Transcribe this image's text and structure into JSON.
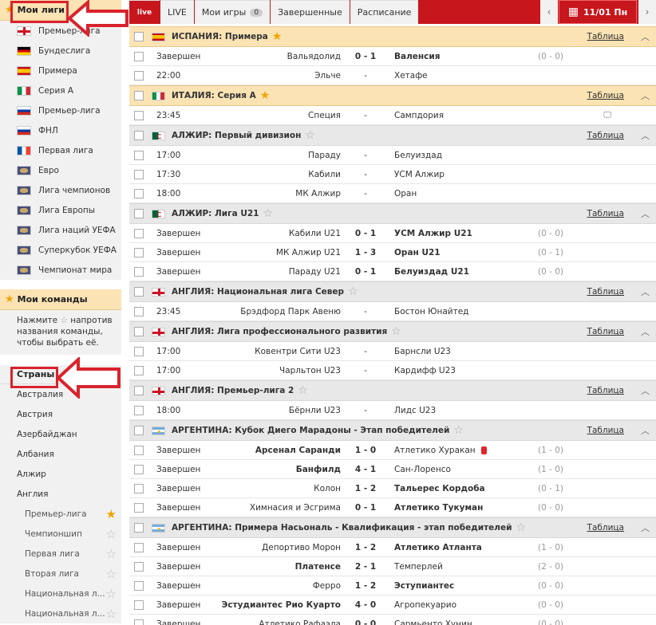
{
  "sidebar": {
    "my_leagues_label": "Мои лиги",
    "leagues": [
      {
        "name": "Премьер-лига",
        "flag": "england"
      },
      {
        "name": "Бундеслига",
        "flag": "germany"
      },
      {
        "name": "Примера",
        "flag": "spain"
      },
      {
        "name": "Серия А",
        "flag": "italy"
      },
      {
        "name": "Премьер-лига",
        "flag": "russia"
      },
      {
        "name": "ФНЛ",
        "flag": "russia"
      },
      {
        "name": "Первая лига",
        "flag": "france"
      },
      {
        "name": "Евро",
        "flag": "world"
      },
      {
        "name": "Лига чемпионов",
        "flag": "world"
      },
      {
        "name": "Лига Европы",
        "flag": "world"
      },
      {
        "name": "Лига наций УЕФА",
        "flag": "world"
      },
      {
        "name": "Суперкубок УЕФА",
        "flag": "world"
      },
      {
        "name": "Чемпионат мира",
        "flag": "world"
      }
    ],
    "my_teams_label": "Мои команды",
    "hint_pre": "Нажмите",
    "hint_post": "напротив названия команды, чтобы выбрать её.",
    "countries_label": "Страны",
    "countries": [
      "Австралия",
      "Австрия",
      "Азербайджан",
      "Албания",
      "Алжир",
      "Англия"
    ],
    "england_leagues": [
      {
        "name": "Премьер-лига",
        "starred": true
      },
      {
        "name": "Чемпионшип",
        "starred": false
      },
      {
        "name": "Первая лига",
        "starred": false
      },
      {
        "name": "Вторая лига",
        "starred": false
      },
      {
        "name": "Национальная л...",
        "starred": false
      },
      {
        "name": "Национальная л...",
        "starred": false
      }
    ]
  },
  "topbar": {
    "logo": "live",
    "tabs": [
      "LIVE",
      "Мои игры",
      "Завершенные",
      "Расписание"
    ],
    "my_games_count": "0",
    "date": "11/01 Пн"
  },
  "table_link": "Таблица",
  "leagues": [
    {
      "title": "ИСПАНИЯ: Примера",
      "flag": "spain",
      "fav": true,
      "matches": [
        {
          "status": "Завершен",
          "home": "Вальядолид",
          "score": "0 - 1",
          "away": "Валенсия",
          "half": "(0 - 0)",
          "away_bold": true
        },
        {
          "status": "22:00",
          "home": "Эльче",
          "score": "-",
          "away": "Хетафе",
          "half": ""
        }
      ]
    },
    {
      "title": "ИТАЛИЯ: Серия А",
      "flag": "italy",
      "fav": true,
      "matches": [
        {
          "status": "23:45",
          "home": "Специя",
          "score": "-",
          "away": "Сампдория",
          "half": "",
          "tv": true
        }
      ]
    },
    {
      "title": "АЛЖИР: Первый дивизион",
      "flag": "algeria",
      "fav": false,
      "matches": [
        {
          "status": "17:00",
          "home": "Параду",
          "score": "-",
          "away": "Белуиздад",
          "half": ""
        },
        {
          "status": "17:30",
          "home": "Кабили",
          "score": "-",
          "away": "УСМ Алжир",
          "half": ""
        },
        {
          "status": "18:00",
          "home": "МК Алжир",
          "score": "-",
          "away": "Оран",
          "half": ""
        }
      ]
    },
    {
      "title": "АЛЖИР: Лига U21",
      "flag": "algeria",
      "fav": false,
      "matches": [
        {
          "status": "Завершен",
          "home": "Кабили U21",
          "score": "0 - 1",
          "away": "УСМ Алжир U21",
          "half": "(0 - 0)",
          "away_bold": true
        },
        {
          "status": "Завершен",
          "home": "МК Алжир U21",
          "score": "1 - 3",
          "away": "Оран U21",
          "half": "(0 - 1)",
          "away_bold": true
        },
        {
          "status": "Завершен",
          "home": "Параду U21",
          "score": "0 - 1",
          "away": "Белуиздад U21",
          "half": "(0 - 0)",
          "away_bold": true
        }
      ]
    },
    {
      "title": "АНГЛИЯ: Национальная лига Север",
      "flag": "england",
      "fav": false,
      "matches": [
        {
          "status": "23:45",
          "home": "Брэдфорд Парк Авеню",
          "score": "-",
          "away": "Бостон Юнайтед",
          "half": ""
        }
      ]
    },
    {
      "title": "АНГЛИЯ: Лига профессионального развития",
      "flag": "england",
      "fav": false,
      "matches": [
        {
          "status": "17:00",
          "home": "Ковентри Сити U23",
          "score": "-",
          "away": "Барнсли U23",
          "half": ""
        },
        {
          "status": "17:00",
          "home": "Чарльтон U23",
          "score": "-",
          "away": "Кардифф U23",
          "half": ""
        }
      ]
    },
    {
      "title": "АНГЛИЯ: Премьер-лига 2",
      "flag": "england",
      "fav": false,
      "matches": [
        {
          "status": "18:00",
          "home": "Бёрнли U23",
          "score": "-",
          "away": "Лидс U23",
          "half": ""
        }
      ]
    },
    {
      "title": "АРГЕНТИНА: Кубок Диего Марадоны - Этап победителей",
      "flag": "argentina",
      "fav": false,
      "matches": [
        {
          "status": "Завершен",
          "home": "Арсенал Саранди",
          "score": "1 - 0",
          "away": "Атлетико Хуракан",
          "half": "(1 - 0)",
          "home_bold": true,
          "redcard": true
        },
        {
          "status": "Завершен",
          "home": "Банфилд",
          "score": "4 - 1",
          "away": "Сан-Лоренсо",
          "half": "(1 - 0)",
          "home_bold": true
        },
        {
          "status": "Завершен",
          "home": "Колон",
          "score": "1 - 2",
          "away": "Тальерес Кордоба",
          "half": "(0 - 1)",
          "away_bold": true
        },
        {
          "status": "Завершен",
          "home": "Химнасия и Эсгрима",
          "score": "0 - 1",
          "away": "Атлетико Тукуман",
          "half": "(0 - 0)",
          "away_bold": true
        }
      ]
    },
    {
      "title": "АРГЕНТИНА: Примера Насьональ - Квалификация - этап победителей",
      "flag": "argentina",
      "fav": false,
      "matches": [
        {
          "status": "Завершен",
          "home": "Депортиво Морон",
          "score": "1 - 2",
          "away": "Атлетико Атланта",
          "half": "(1 - 0)",
          "away_bold": true
        },
        {
          "status": "Завершен",
          "home": "Платенсе",
          "score": "2 - 1",
          "away": "Темперлей",
          "half": "(2 - 0)",
          "home_bold": true
        },
        {
          "status": "Завершен",
          "home": "Ферро",
          "score": "1 - 2",
          "away": "Эступиантес",
          "half": "(0 - 0)",
          "away_bold": true
        },
        {
          "status": "Завершен",
          "home": "Эстудиантес Рио Куарто",
          "score": "4 - 0",
          "away": "Агропекуарио",
          "half": "(0 - 0)",
          "home_bold": true
        },
        {
          "status": "Завершен",
          "home": "Атлетико Рафаэла",
          "score": "0 - 0",
          "away": "Сармьенто Хунин",
          "half": "(0 - 0)"
        }
      ]
    }
  ]
}
